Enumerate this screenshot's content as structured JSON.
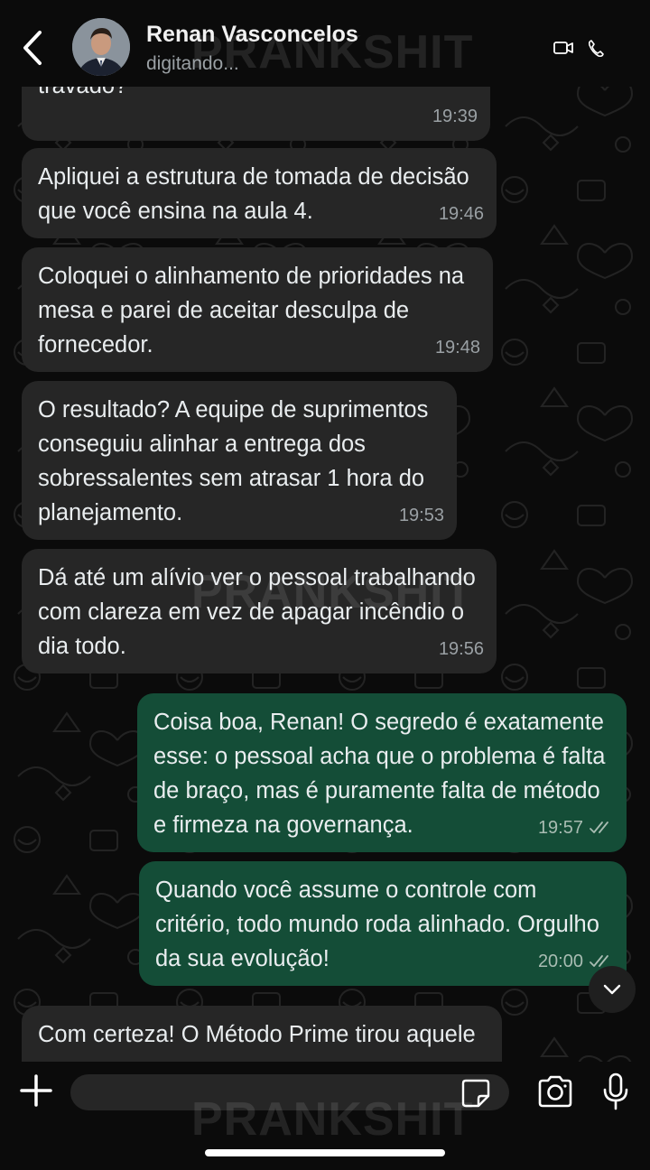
{
  "contact": {
    "name": "Renan Vasconcelos",
    "status": "digitando..."
  },
  "watermark": "PRANKSHIT",
  "icons": {
    "back": "chevron-left-icon",
    "video": "video-call-icon",
    "phone": "phone-icon",
    "scroll": "chevron-down-icon",
    "plus": "plus-icon",
    "sticker": "sticker-icon",
    "camera": "camera-icon",
    "mic": "microphone-icon",
    "read": "double-check-icon"
  },
  "colors": {
    "incoming_bubble": "#262626",
    "outgoing_bubble": "#144d37",
    "background": "#0b0b0b",
    "read_receipt": "#a8bcb2"
  },
  "messages": [
    {
      "dir": "in",
      "text": "travado?",
      "time": "19:39"
    },
    {
      "dir": "in",
      "text": "Apliquei a estrutura de tomada de decisão\nque você ensina na aula 4.",
      "time": "19:46"
    },
    {
      "dir": "in",
      "text": "Coloquei o alinhamento de prioridades na\nmesa e parei de aceitar desculpa de\nfornecedor.",
      "time": "19:48"
    },
    {
      "dir": "in",
      "text": "O resultado? A equipe de suprimentos\nconseguiu alinhar a entrega dos\nsobressalentes sem atrasar 1 hora do\nplanejamento.",
      "time": "19:53"
    },
    {
      "dir": "in",
      "text": "Dá até um alívio ver o pessoal trabalhando\ncom clareza em vez de apagar incêndio o\ndia todo.",
      "time": "19:56"
    },
    {
      "dir": "out",
      "text": "Coisa boa, Renan! O segredo é exatamente\nesse: o pessoal acha que o problema é falta\nde braço, mas é puramente falta de método\ne firmeza na governança.",
      "time": "19:57"
    },
    {
      "dir": "out",
      "text": "Quando você assume o controle com\ncritério, todo mundo roda alinhado. Orgulho\nda sua evolução!",
      "time": "20:00"
    },
    {
      "dir": "in",
      "text": "Com certeza! O Método Prime tirou aquele",
      "time": ""
    }
  ]
}
